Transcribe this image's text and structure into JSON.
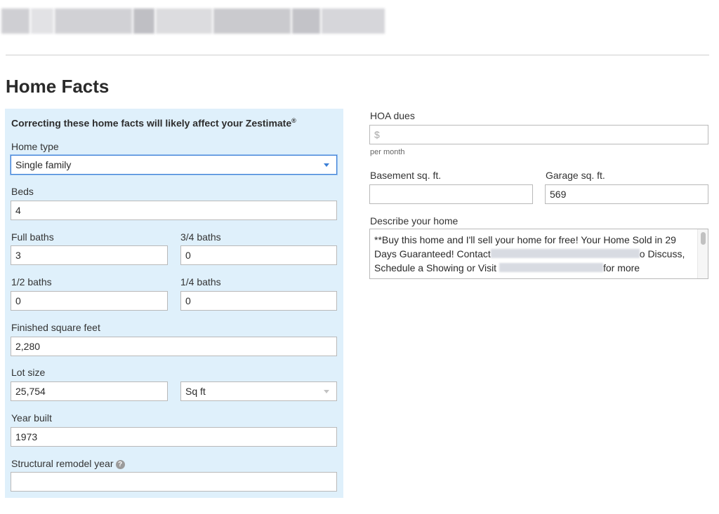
{
  "page_title": "Home Facts",
  "facts_panel": {
    "heading": "Correcting these home facts will likely affect your Zestimate",
    "heading_mark": "®",
    "home_type": {
      "label": "Home type",
      "value": "Single family"
    },
    "beds": {
      "label": "Beds",
      "value": "4"
    },
    "full_baths": {
      "label": "Full baths",
      "value": "3"
    },
    "three_quarter_baths": {
      "label": "3/4 baths",
      "value": "0"
    },
    "half_baths": {
      "label": "1/2 baths",
      "value": "0"
    },
    "quarter_baths": {
      "label": "1/4 baths",
      "value": "0"
    },
    "finished_sqft": {
      "label": "Finished square feet",
      "value": "2,280"
    },
    "lot_size": {
      "label": "Lot size",
      "value": "25,754",
      "unit": "Sq ft"
    },
    "year_built": {
      "label": "Year built",
      "value": "1973"
    },
    "remodel_year": {
      "label": "Structural remodel year",
      "value": "",
      "help_glyph": "?"
    }
  },
  "other_facts": {
    "hoa_dues": {
      "label": "HOA dues",
      "placeholder": "$",
      "hint": "per month"
    },
    "basement_sqft": {
      "label": "Basement sq. ft.",
      "value": ""
    },
    "garage_sqft": {
      "label": "Garage sq. ft.",
      "value": "569"
    },
    "description": {
      "label": "Describe your home",
      "line1": "**Buy this home and I'll sell your home for free! Your Home Sold in 29",
      "line2_a": "Days Guaranteed! Contact",
      "line2_b": "o Discuss,",
      "line3_a": "Schedule a Showing or Visit",
      "line3_b": "for more"
    }
  },
  "colors": {
    "panel_bg": "#dff0fb",
    "focus_border": "#3b7fd6"
  }
}
